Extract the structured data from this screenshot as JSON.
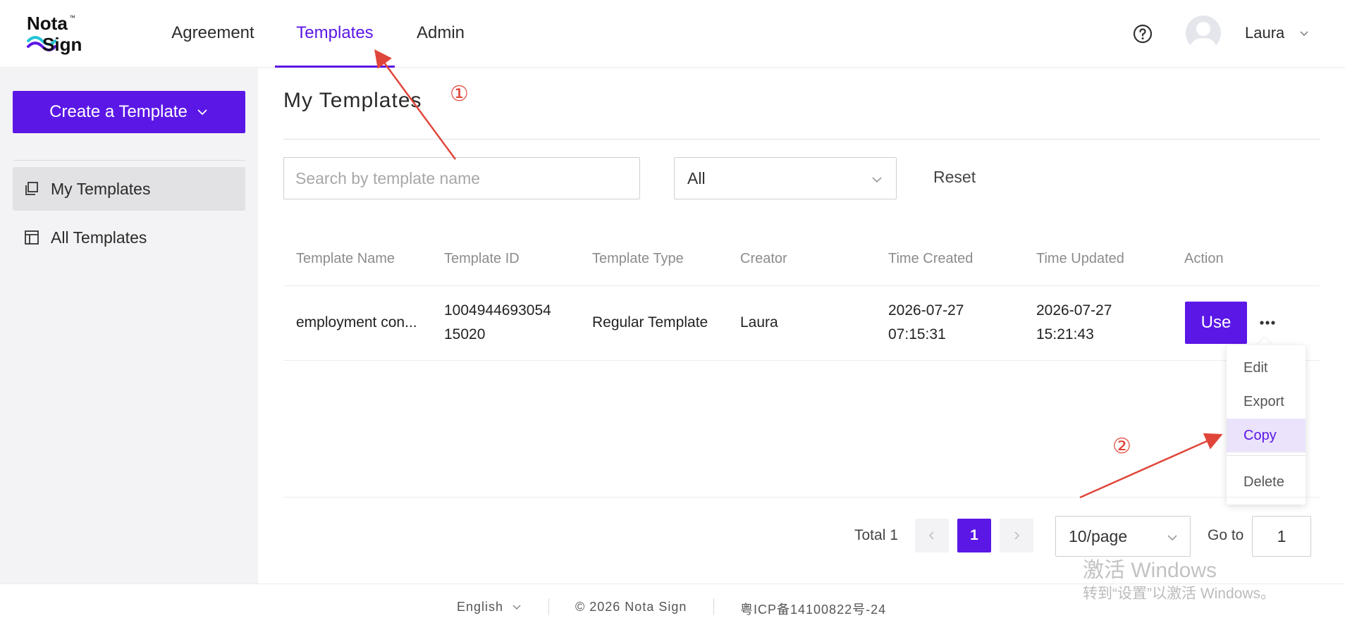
{
  "header": {
    "logo_text_top": "Nota",
    "logo_text_bottom": "Sign",
    "logo_tm": "™",
    "nav": [
      {
        "label": "Agreement"
      },
      {
        "label": "Templates"
      },
      {
        "label": "Admin"
      }
    ],
    "user_name": "Laura"
  },
  "sidebar": {
    "create_button": "Create a Template",
    "items": [
      {
        "label": "My Templates"
      },
      {
        "label": "All Templates"
      }
    ]
  },
  "main": {
    "title": "My Templates",
    "search": {
      "placeholder": "Search by template name",
      "value": ""
    },
    "filter": {
      "selected": "All"
    },
    "reset_label": "Reset",
    "table": {
      "columns": [
        "Template Name",
        "Template ID",
        "Template Type",
        "Creator",
        "Time Created",
        "Time Updated",
        "Action"
      ],
      "rows": [
        {
          "name": "employment con...",
          "id_line1": "1004944693054",
          "id_line2": "15020",
          "type": "Regular Template",
          "creator": "Laura",
          "created_date": "2026-07-27",
          "created_time": "07:15:31",
          "updated_date": "2026-07-27",
          "updated_time": "15:21:43",
          "use_label": "Use"
        }
      ]
    },
    "action_menu": [
      "Edit",
      "Export",
      "Copy",
      "Delete"
    ],
    "pagination": {
      "total_label": "Total 1",
      "current_page": "1",
      "page_size": "10/page",
      "goto_label": "Go to",
      "goto_value": "1"
    }
  },
  "footer": {
    "language": "English",
    "copyright": "© 2026 Nota Sign",
    "icp": "粤ICP备14100822号-24"
  },
  "watermark": {
    "title": "激活 Windows",
    "subtitle": "转到“设置”以激活 Windows。"
  },
  "annotations": {
    "marker_1": "①",
    "marker_2": "②",
    "color": "#e0453a"
  },
  "colors": {
    "accent": "#5b17e6",
    "sidebar_bg": "#f3f3f5"
  }
}
